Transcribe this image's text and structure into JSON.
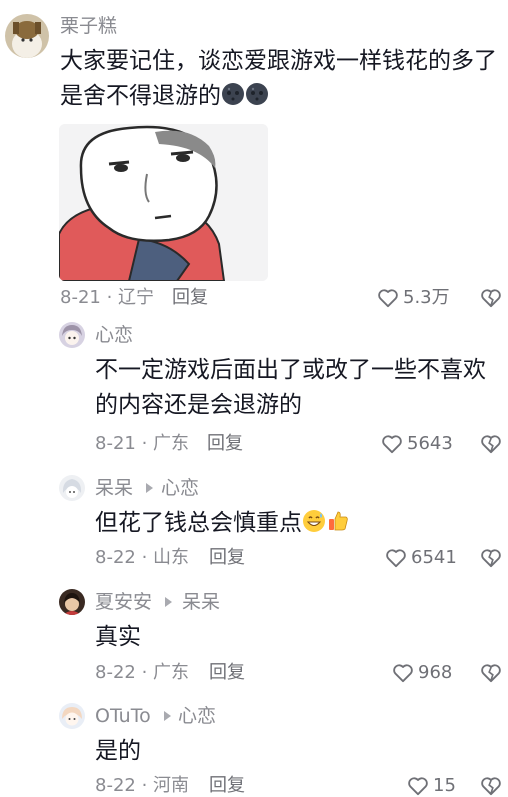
{
  "comments": [
    {
      "username": "栗子糕",
      "text": "大家要记住，谈恋爱跟游戏一样钱花的多了是舍不得退游的",
      "emoji": [
        "dark-moon-emoji",
        "dark-moon-emoji"
      ],
      "date_location": "8-21 · 辽宁",
      "reply_label": "回复",
      "likes": "5.3万",
      "has_sticker": true
    },
    {
      "username": "心恋",
      "text": "不一定游戏后面出了或改了一些不喜欢的内容还是会退游的",
      "date_location": "8-21 · 广东",
      "reply_label": "回复",
      "likes": "5643"
    },
    {
      "username": "呆呆",
      "reply_to": "心恋",
      "text": "但花了钱总会慎重点",
      "emoji": [
        "grinning-sweat-emoji",
        "thumbs-up-emoji"
      ],
      "date_location": "8-22 · 山东",
      "reply_label": "回复",
      "likes": "6541"
    },
    {
      "username": "夏安安",
      "reply_to": "呆呆",
      "text": "真实",
      "date_location": "8-22 · 广东",
      "reply_label": "回复",
      "likes": "968"
    },
    {
      "username": "OTuTo",
      "reply_to": "心恋",
      "text": "是的",
      "date_location": "8-22 · 河南",
      "reply_label": "回复",
      "likes": "15"
    }
  ],
  "colors": {
    "text": "#161823",
    "meta": "#8a8b91",
    "icon": "#6f7076"
  }
}
